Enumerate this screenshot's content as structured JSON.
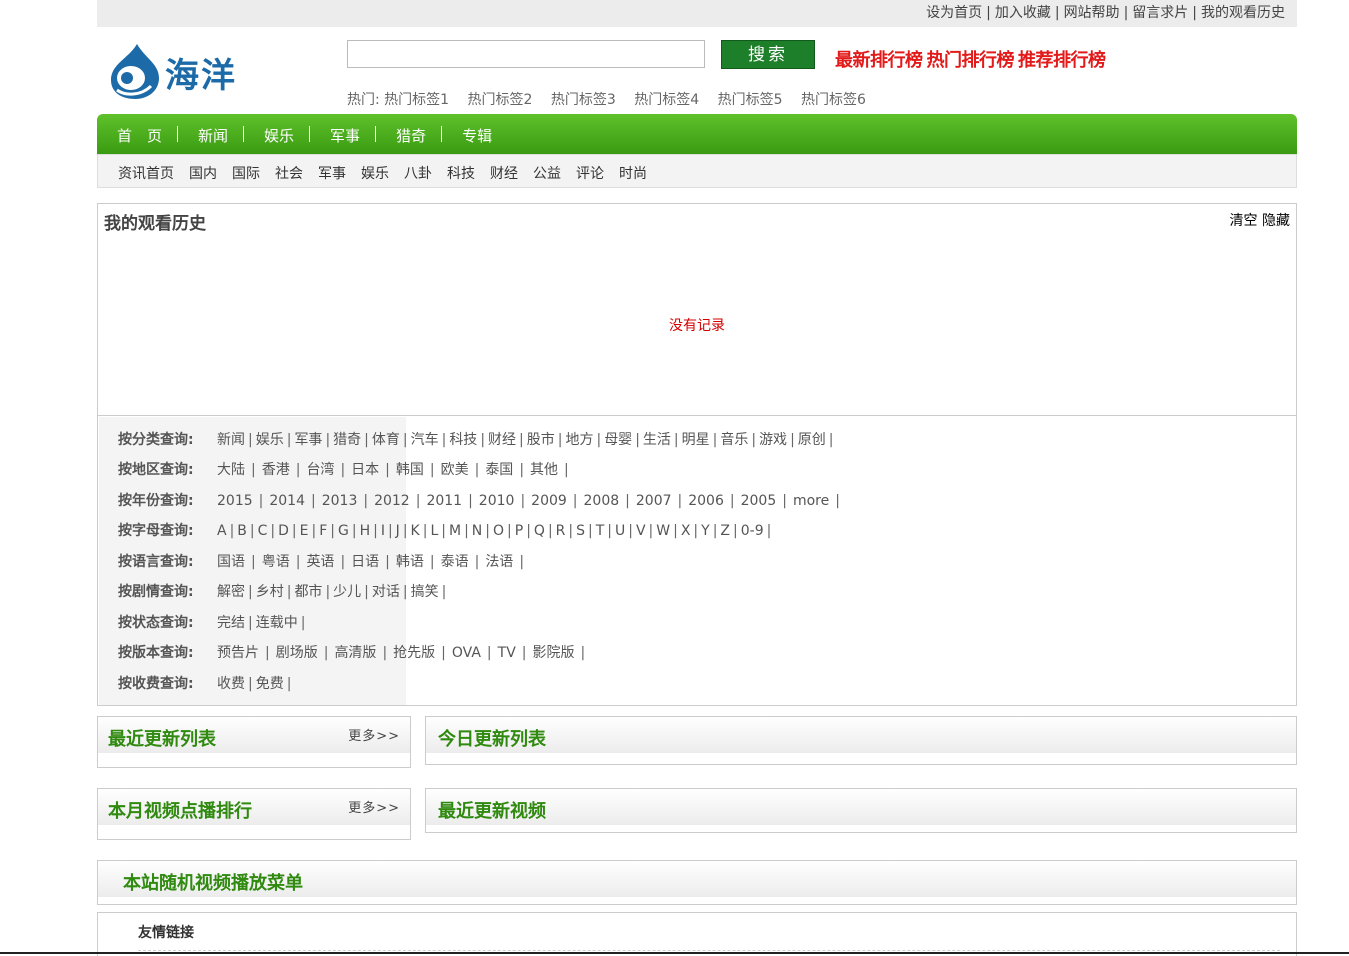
{
  "topbar": {
    "links": [
      "设为首页",
      "加入收藏",
      "网站帮助",
      "留言求片",
      "我的观看历史"
    ]
  },
  "logo": {
    "text": "海洋",
    "icon": "drop-logo-icon"
  },
  "search": {
    "placeholder": "",
    "button": "搜索"
  },
  "ranks": [
    "最新排行榜",
    "热门排行榜",
    "推荐排行榜"
  ],
  "hot": {
    "label": "热门:",
    "tags": [
      "热门标签1",
      "热门标签2",
      "热门标签3",
      "热门标签4",
      "热门标签5",
      "热门标签6"
    ]
  },
  "nav": [
    "首　页",
    "新闻",
    "娱乐",
    "军事",
    "猎奇",
    "专辑"
  ],
  "subnav": [
    "资讯首页",
    "国内",
    "国际",
    "社会",
    "军事",
    "娱乐",
    "八卦",
    "科技",
    "财经",
    "公益",
    "评论",
    "时尚"
  ],
  "history": {
    "title": "我的观看历史",
    "clear": "清空",
    "hide": "隐藏",
    "empty": "没有记录"
  },
  "filters": [
    {
      "label": "按分类查询:",
      "options": [
        "新闻",
        "娱乐",
        "军事",
        "猎奇",
        "体育",
        "汽车",
        "科技",
        "财经",
        "股市",
        "地方",
        "母婴",
        "生活",
        "明星",
        "音乐",
        "游戏",
        "原创"
      ]
    },
    {
      "label": "按地区查询:",
      "options": [
        "大陆",
        "香港",
        "台湾",
        "日本",
        "韩国",
        "欧美",
        "泰国",
        "其他"
      ]
    },
    {
      "label": "按年份查询:",
      "options": [
        "2015",
        "2014",
        "2013",
        "2012",
        "2011",
        "2010",
        "2009",
        "2008",
        "2007",
        "2006",
        "2005",
        "more"
      ]
    },
    {
      "label": "按字母查询:",
      "options": [
        "A",
        "B",
        "C",
        "D",
        "E",
        "F",
        "G",
        "H",
        "I",
        "J",
        "K",
        "L",
        "M",
        "N",
        "O",
        "P",
        "Q",
        "R",
        "S",
        "T",
        "U",
        "V",
        "W",
        "X",
        "Y",
        "Z",
        "0-9"
      ]
    },
    {
      "label": "按语言查询:",
      "options": [
        "国语",
        "粤语",
        "英语",
        "日语",
        "韩语",
        "泰语",
        "法语"
      ]
    },
    {
      "label": "按剧情查询:",
      "options": [
        "解密",
        "乡村",
        "都市",
        "少儿",
        "对话",
        "搞笑"
      ]
    },
    {
      "label": "按状态查询:",
      "options": [
        "完结",
        "连载中"
      ]
    },
    {
      "label": "按版本查询:",
      "options": [
        "预告片",
        "剧场版",
        "高清版",
        "抢先版",
        "OVA",
        "TV",
        "影院版"
      ]
    },
    {
      "label": "按收费查询:",
      "options": [
        "收费",
        "免费"
      ]
    }
  ],
  "boxes": {
    "recent_list": {
      "title": "最近更新列表",
      "more": "更多>>"
    },
    "today_list": {
      "title": "今日更新列表"
    },
    "monthly_rank": {
      "title": "本月视频点播排行",
      "more": "更多>>"
    },
    "recent_video": {
      "title": "最近更新视频"
    },
    "random_menu": {
      "title": "本站随机视频播放菜单"
    }
  },
  "friends": {
    "title": "友情链接"
  }
}
